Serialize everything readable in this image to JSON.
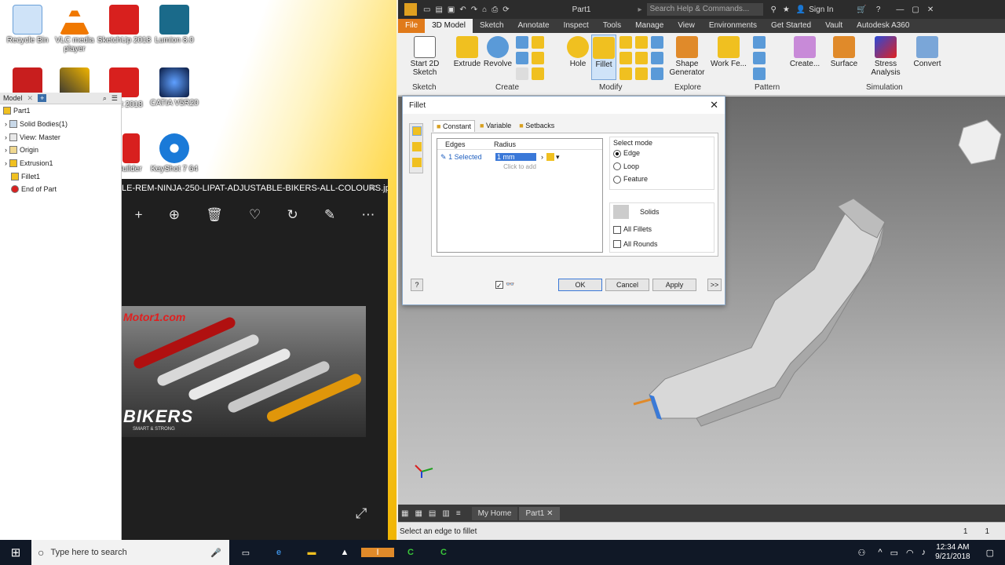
{
  "desktop": {
    "icons": [
      {
        "label": "Recycle Bin",
        "icon": "recycle-bin-icon",
        "color": "#6aa0d8"
      },
      {
        "label": "VLC media player",
        "icon": "vlc-icon",
        "color": "#f07800"
      },
      {
        "label": "SketchUp 2018",
        "icon": "sketchup-icon",
        "color": "#d8201e"
      },
      {
        "label": "Lumion 8.0",
        "icon": "lumion-icon",
        "color": "#1a6a8a"
      },
      {
        "label": "",
        "icon": "acrobat-icon",
        "color": "#c81e1e"
      },
      {
        "label": "",
        "icon": "winrar-icon",
        "color": "#6a3a8a"
      },
      {
        "label": "",
        "icon": "sketchup-layout-icon",
        "color": "#d8201e"
      },
      {
        "label": "CATIA V5R20",
        "icon": "catia-icon",
        "color": "#183a7a"
      },
      {
        "label": "at 2018",
        "icon": "desktop-app-icon",
        "color": "#d8201e"
      },
      {
        "label": "Builder",
        "icon": "style-builder-icon",
        "color": "#d8201e"
      },
      {
        "label": "KeyShot 7 64",
        "icon": "keyshot-icon",
        "color": "#1a7ad8"
      }
    ]
  },
  "browser": {
    "title": "Model",
    "tree": [
      {
        "label": "Part1",
        "icon": "part-icon",
        "indent": 0
      },
      {
        "label": "Solid Bodies(1)",
        "icon": "solid-bodies-icon",
        "indent": 1
      },
      {
        "label": "View: Master",
        "icon": "view-icon",
        "indent": 1
      },
      {
        "label": "Origin",
        "icon": "folder-icon",
        "indent": 1
      },
      {
        "label": "Extrusion1",
        "icon": "extrusion-icon",
        "indent": 1
      },
      {
        "label": "Fillet1",
        "icon": "fillet-icon",
        "indent": 1
      },
      {
        "label": "End of Part",
        "icon": "end-of-part-icon",
        "indent": 1
      }
    ]
  },
  "photos": {
    "filename": "LE-REM-NINJA-250-LIPAT-ADJUSTABLE-BIKERS-ALL-COLOURS.jpg",
    "watermark": "Motor1.com",
    "brand": "BIKERS",
    "brand_sub": "SMART & STRONG"
  },
  "inventor": {
    "doc_title": "Part1",
    "search_placeholder": "Search Help & Commands...",
    "sign_in": "Sign In",
    "tabs": [
      "File",
      "3D Model",
      "Sketch",
      "Annotate",
      "Inspect",
      "Tools",
      "Manage",
      "View",
      "Environments",
      "Get Started",
      "Vault",
      "Autodesk A360"
    ],
    "active_tab": "3D Model",
    "ribbon": {
      "start_sketch": "Start 2D Sketch",
      "extrude": "Extrude",
      "revolve": "Revolve",
      "hole": "Hole",
      "fillet": "Fillet",
      "shape_generator": "Shape Generator",
      "work_features": "Work Fe...",
      "create": "Create...",
      "surface": "Surface",
      "stress_analysis": "Stress Analysis",
      "convert": "Convert",
      "panels": [
        "Sketch",
        "Create",
        "Modify",
        "Explore",
        "Pattern",
        "Simulation"
      ]
    },
    "doc_tabs": [
      "My Home",
      "Part1"
    ],
    "status_text": "Select an edge to fillet",
    "status_count_1": "1",
    "status_count_2": "1"
  },
  "fillet": {
    "title": "Fillet",
    "tabs": [
      "Constant",
      "Variable",
      "Setbacks"
    ],
    "col_edges": "Edges",
    "col_radius": "Radius",
    "row_edges": "1 Selected",
    "row_radius": "1 mm",
    "click_to_add": "Click to add",
    "select_mode_label": "Select mode",
    "modes": [
      "Edge",
      "Loop",
      "Feature"
    ],
    "selected_mode": "Edge",
    "solids_label": "Solids",
    "all_fillets": "All Fillets",
    "all_rounds": "All Rounds",
    "ok": "OK",
    "cancel": "Cancel",
    "apply": "Apply",
    "more": ">>"
  },
  "taskbar": {
    "search_placeholder": "Type here to search",
    "time": "12:34 AM",
    "date": "9/21/2018"
  },
  "colors": {
    "taskbar": "#101826",
    "inventor_dark": "#2c2c2c",
    "file_tab": "#e07a1a",
    "fillet_highlight": "#cfe3f8"
  }
}
